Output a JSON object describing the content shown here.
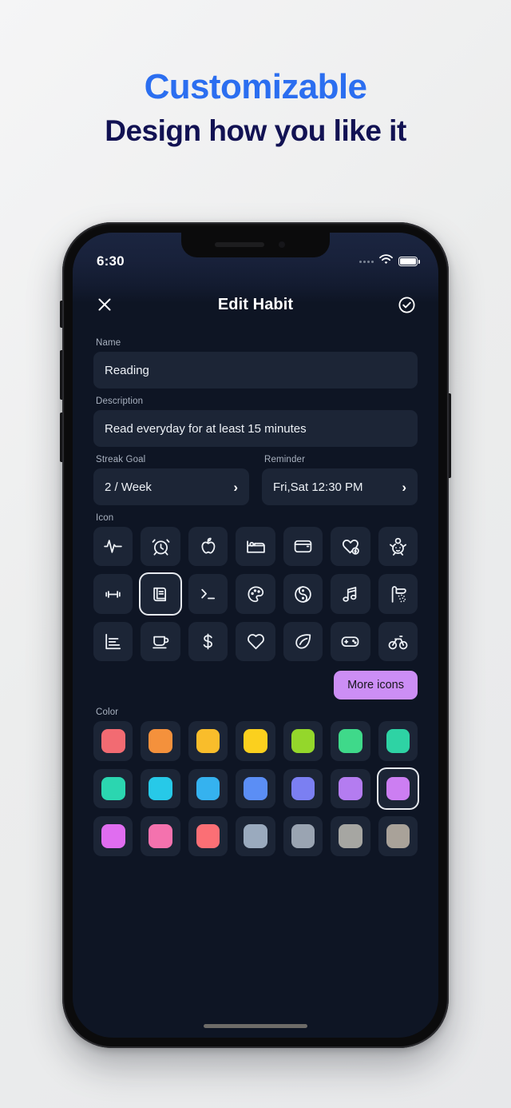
{
  "headline": {
    "line1": "Customizable",
    "line2": "Design how you like it",
    "accent_color": "#2b6ef0",
    "dark_color": "#121253"
  },
  "status_bar": {
    "time": "6:30",
    "signal_icon": "signal-dots-icon",
    "wifi_icon": "wifi-icon",
    "battery_icon": "battery-full-icon"
  },
  "app_header": {
    "close_label": "close-icon",
    "title": "Edit Habit",
    "confirm_label": "check-circle-icon"
  },
  "form": {
    "name": {
      "label": "Name",
      "value": "Reading",
      "placeholder": "Name"
    },
    "description": {
      "label": "Description",
      "value": "Read everyday for at least 15 minutes",
      "placeholder": "Description"
    },
    "streak_goal": {
      "label": "Streak Goal",
      "value": "2 / Week"
    },
    "reminder": {
      "label": "Reminder",
      "value": "Fri,Sat 12:30 PM"
    }
  },
  "icon_section": {
    "label": "Icon",
    "more_button": "More icons",
    "more_button_color": "#cc8ef5",
    "selected_index": 8,
    "icons": [
      "activity-pulse-icon",
      "alarm-clock-icon",
      "apple-icon",
      "bed-icon",
      "wallet-icon",
      "heart-bolt-icon",
      "baby-icon",
      "dumbbell-icon",
      "book-icon",
      "terminal-icon",
      "palette-icon",
      "yin-yang-icon",
      "music-note-icon",
      "shower-icon",
      "bar-chart-icon",
      "coffee-cup-icon",
      "dollar-icon",
      "heart-icon",
      "leaf-icon",
      "gamepad-icon",
      "bicycle-icon"
    ]
  },
  "color_section": {
    "label": "Color",
    "selected_index": 13,
    "colors": [
      "#f26b72",
      "#f4913c",
      "#f9bd2b",
      "#fbd01e",
      "#94d72b",
      "#3fd98a",
      "#2ed3a4",
      "#2bd6b0",
      "#27c9e8",
      "#35b2ef",
      "#5b8ef5",
      "#7b7ff2",
      "#b47cf0",
      "#cc7ef2",
      "#e06df0",
      "#f472ae",
      "#fb6f75",
      "#9aaabe",
      "#9aa4b2",
      "#a6a6a2",
      "#a9a299"
    ]
  },
  "home_indicator": "home-indicator"
}
